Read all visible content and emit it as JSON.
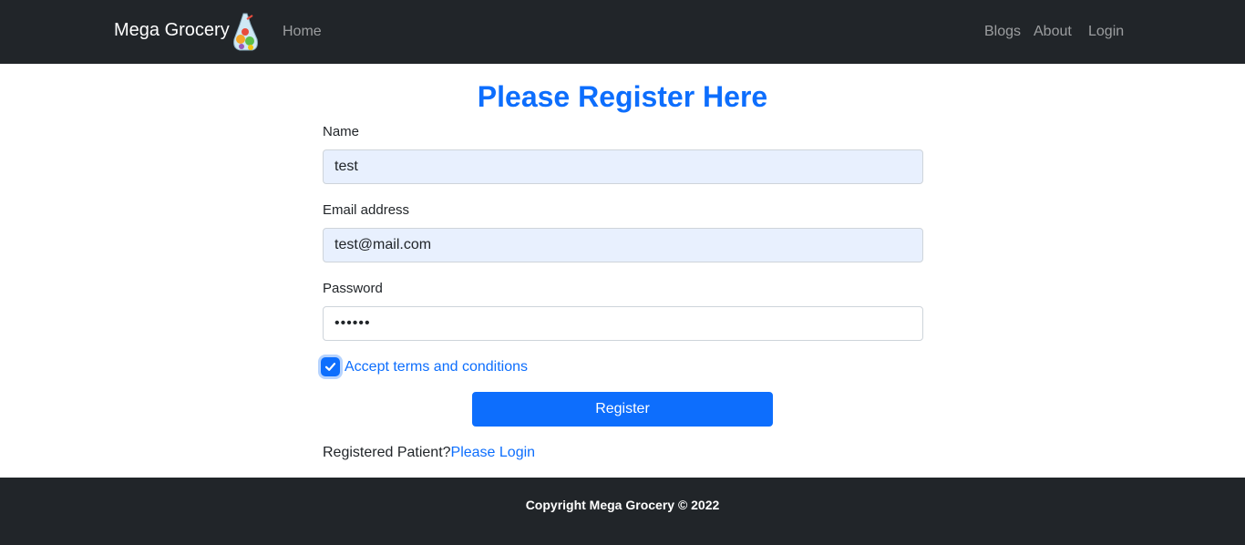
{
  "navbar": {
    "brand": "Mega Grocery",
    "brand_logo_icon": "grocery-bag-logo-icon",
    "links": {
      "home": "Home",
      "blogs": "Blogs",
      "about": "About",
      "login": "Login"
    }
  },
  "form": {
    "heading": "Please Register Here",
    "name_label": "Name",
    "name_value": "test",
    "email_label": "Email address",
    "email_value": "test@mail.com",
    "password_label": "Password",
    "password_value": "••••••",
    "terms_checked": true,
    "terms_label": "Accept terms and conditions",
    "submit_label": "Register",
    "registered_prompt": "Registered Patient?",
    "login_link": "Please Login"
  },
  "footer": {
    "text": "Copyright Mega Grocery © 2022"
  },
  "colors": {
    "navbar_bg": "#212529",
    "primary": "#0d6efd",
    "autofill_bg": "#e8f0fe"
  }
}
